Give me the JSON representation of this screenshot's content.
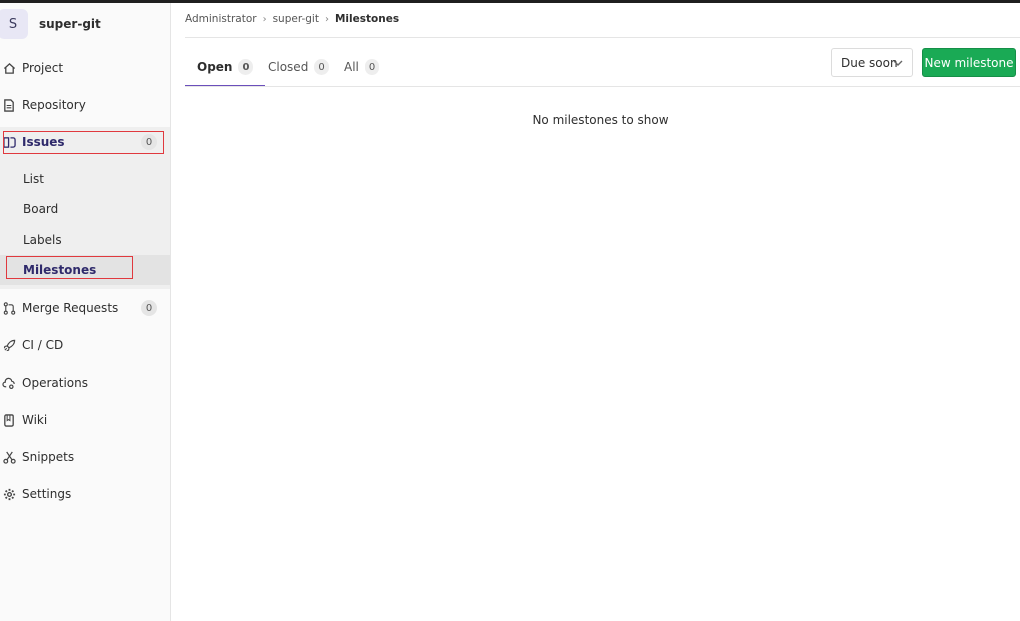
{
  "project": {
    "avatar_letter": "S",
    "name": "super-git"
  },
  "sidebar": {
    "items": [
      {
        "label": "Project",
        "icon": "home-icon"
      },
      {
        "label": "Repository",
        "icon": "document-icon"
      },
      {
        "label": "Issues",
        "icon": "issues-icon",
        "count": "0"
      },
      {
        "label": "Merge Requests",
        "icon": "merge-request-icon",
        "count": "0"
      },
      {
        "label": "CI / CD",
        "icon": "rocket-icon"
      },
      {
        "label": "Operations",
        "icon": "cloud-gear-icon"
      },
      {
        "label": "Wiki",
        "icon": "book-icon"
      },
      {
        "label": "Snippets",
        "icon": "scissors-icon"
      },
      {
        "label": "Settings",
        "icon": "gear-icon"
      }
    ],
    "issues_sub": [
      "List",
      "Board",
      "Labels",
      "Milestones"
    ]
  },
  "breadcrumb": {
    "items": [
      "Administrator",
      "super-git"
    ],
    "current": "Milestones"
  },
  "tabs": [
    {
      "label": "Open",
      "count": "0"
    },
    {
      "label": "Closed",
      "count": "0"
    },
    {
      "label": "All",
      "count": "0"
    }
  ],
  "sort": {
    "selected": "Due soon"
  },
  "new_button": "New milestone",
  "empty_message": "No milestones to show",
  "colors": {
    "accent": "#6b4fbb",
    "success": "#1aaa55",
    "highlight_box": "#e0393e"
  }
}
